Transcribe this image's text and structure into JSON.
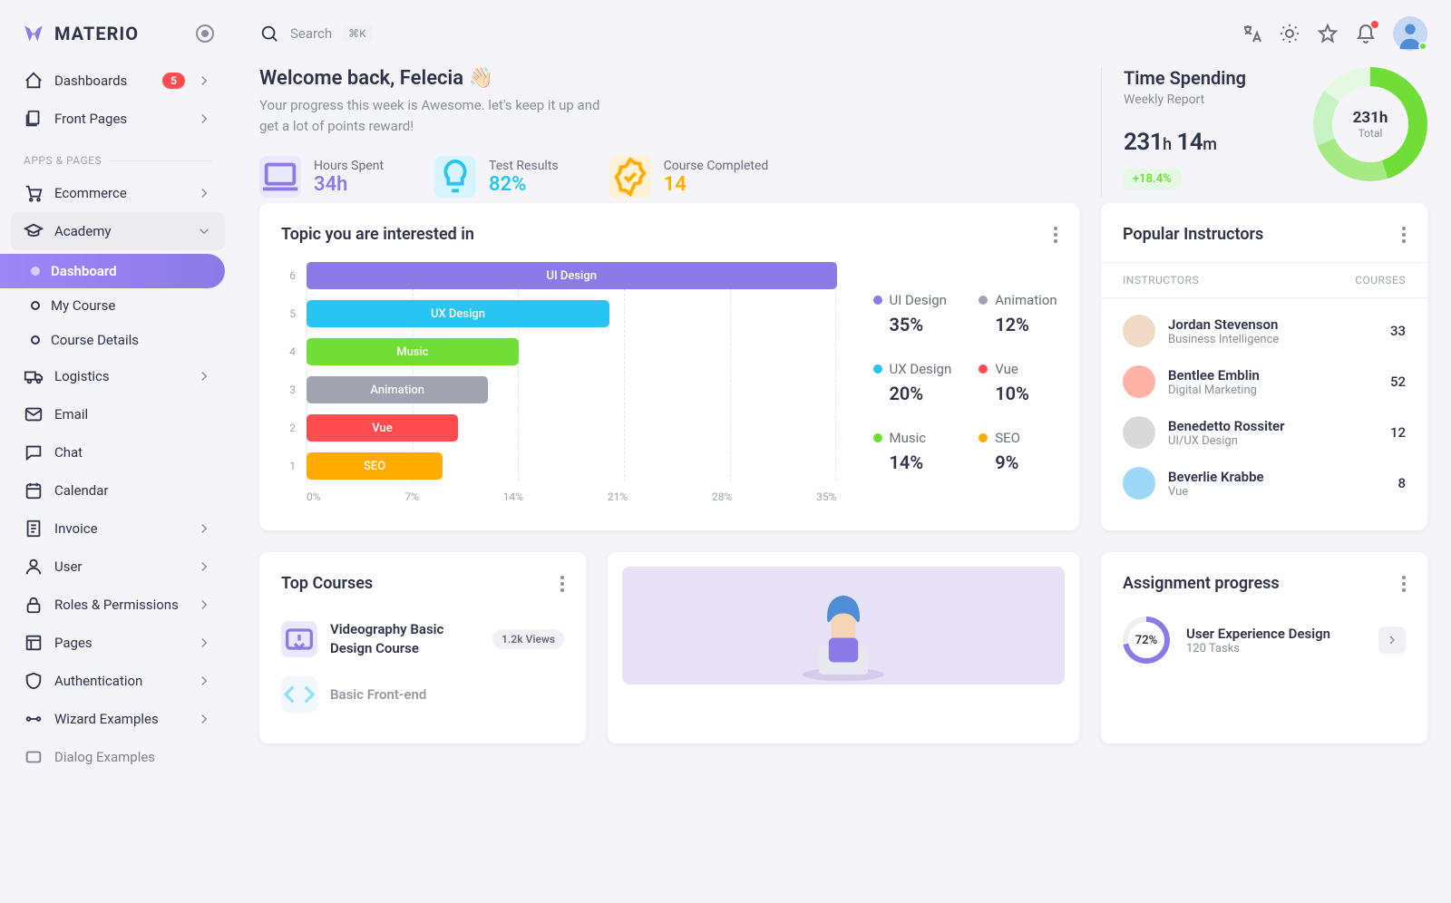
{
  "brand": "MATERIO",
  "search": {
    "placeholder": "Search",
    "kbd": "⌘K"
  },
  "sidebar": {
    "dashboards": {
      "label": "Dashboards",
      "badge": "5"
    },
    "front_pages": {
      "label": "Front Pages"
    },
    "section_apps": "APPS & PAGES",
    "ecommerce": "Ecommerce",
    "academy": {
      "label": "Academy",
      "sub": [
        "Dashboard",
        "My Course",
        "Course Details"
      ]
    },
    "logistics": "Logistics",
    "email": "Email",
    "chat": "Chat",
    "calendar": "Calendar",
    "invoice": "Invoice",
    "user": "User",
    "roles": "Roles & Permissions",
    "pages": "Pages",
    "auth": "Authentication",
    "wizard": "Wizard Examples",
    "dialog": "Dialog Examples"
  },
  "welcome": {
    "title": "Welcome back, Felecia 👋🏻",
    "subtitle": "Your progress this week is Awesome. let's keep it up and get a lot of points reward!",
    "stats": [
      {
        "label": "Hours Spent",
        "value": "34h"
      },
      {
        "label": "Test Results",
        "value": "82%"
      },
      {
        "label": "Course Completed",
        "value": "14"
      }
    ]
  },
  "time": {
    "title": "Time Spending",
    "subtitle": "Weekly Report",
    "value_h": "231",
    "value_m": "14",
    "badge": "+18.4%",
    "donut_value": "231h",
    "donut_label": "Total"
  },
  "chart_data": {
    "type": "bar",
    "title": "Topic you are interested in",
    "ylabels": [
      "6",
      "5",
      "4",
      "3",
      "2",
      "1"
    ],
    "xlabels": [
      "0%",
      "7%",
      "14%",
      "21%",
      "28%",
      "35%"
    ],
    "xlim": [
      0,
      35
    ],
    "series": [
      {
        "name": "UI Design",
        "value": 35,
        "color": "#8c7ae6"
      },
      {
        "name": "UX Design",
        "value": 20,
        "color": "#28c4f2"
      },
      {
        "name": "Music",
        "value": 14,
        "color": "#71dd37"
      },
      {
        "name": "Animation",
        "value": 12,
        "color": "#a1a3ae"
      },
      {
        "name": "Vue",
        "value": 10,
        "color": "#ff4c51"
      },
      {
        "name": "SEO",
        "value": 9,
        "color": "#ffab00"
      }
    ],
    "legend": [
      {
        "name": "UI Design",
        "pct": "35%",
        "color": "#8c7ae6"
      },
      {
        "name": "Animation",
        "pct": "12%",
        "color": "#a1a3ae"
      },
      {
        "name": "UX Design",
        "pct": "20%",
        "color": "#28c4f2"
      },
      {
        "name": "Vue",
        "pct": "10%",
        "color": "#ff4c51"
      },
      {
        "name": "Music",
        "pct": "14%",
        "color": "#71dd37"
      },
      {
        "name": "SEO",
        "pct": "9%",
        "color": "#ffab00"
      }
    ]
  },
  "instructors": {
    "title": "Popular Instructors",
    "cols": [
      "INSTRUCTORS",
      "COURSES"
    ],
    "rows": [
      {
        "name": "Jordan Stevenson",
        "role": "Business Intelligence",
        "count": "33",
        "color": "#f0d9c5"
      },
      {
        "name": "Bentlee Emblin",
        "role": "Digital Marketing",
        "count": "52",
        "color": "#ffb3a7"
      },
      {
        "name": "Benedetto Rossiter",
        "role": "UI/UX Design",
        "count": "12",
        "color": "#d9d9d9"
      },
      {
        "name": "Beverlie Krabbe",
        "role": "Vue",
        "count": "8",
        "color": "#9fd8f7"
      }
    ]
  },
  "top_courses": {
    "title": "Top Courses",
    "items": [
      {
        "title": "Videography Basic Design Course",
        "views": "1.2k Views"
      },
      {
        "title": "Basic Front-end",
        "views": ""
      }
    ]
  },
  "assignment": {
    "title": "Assignment progress",
    "items": [
      {
        "pct": "72%",
        "name": "User Experience Design",
        "sub": "120 Tasks"
      }
    ]
  }
}
